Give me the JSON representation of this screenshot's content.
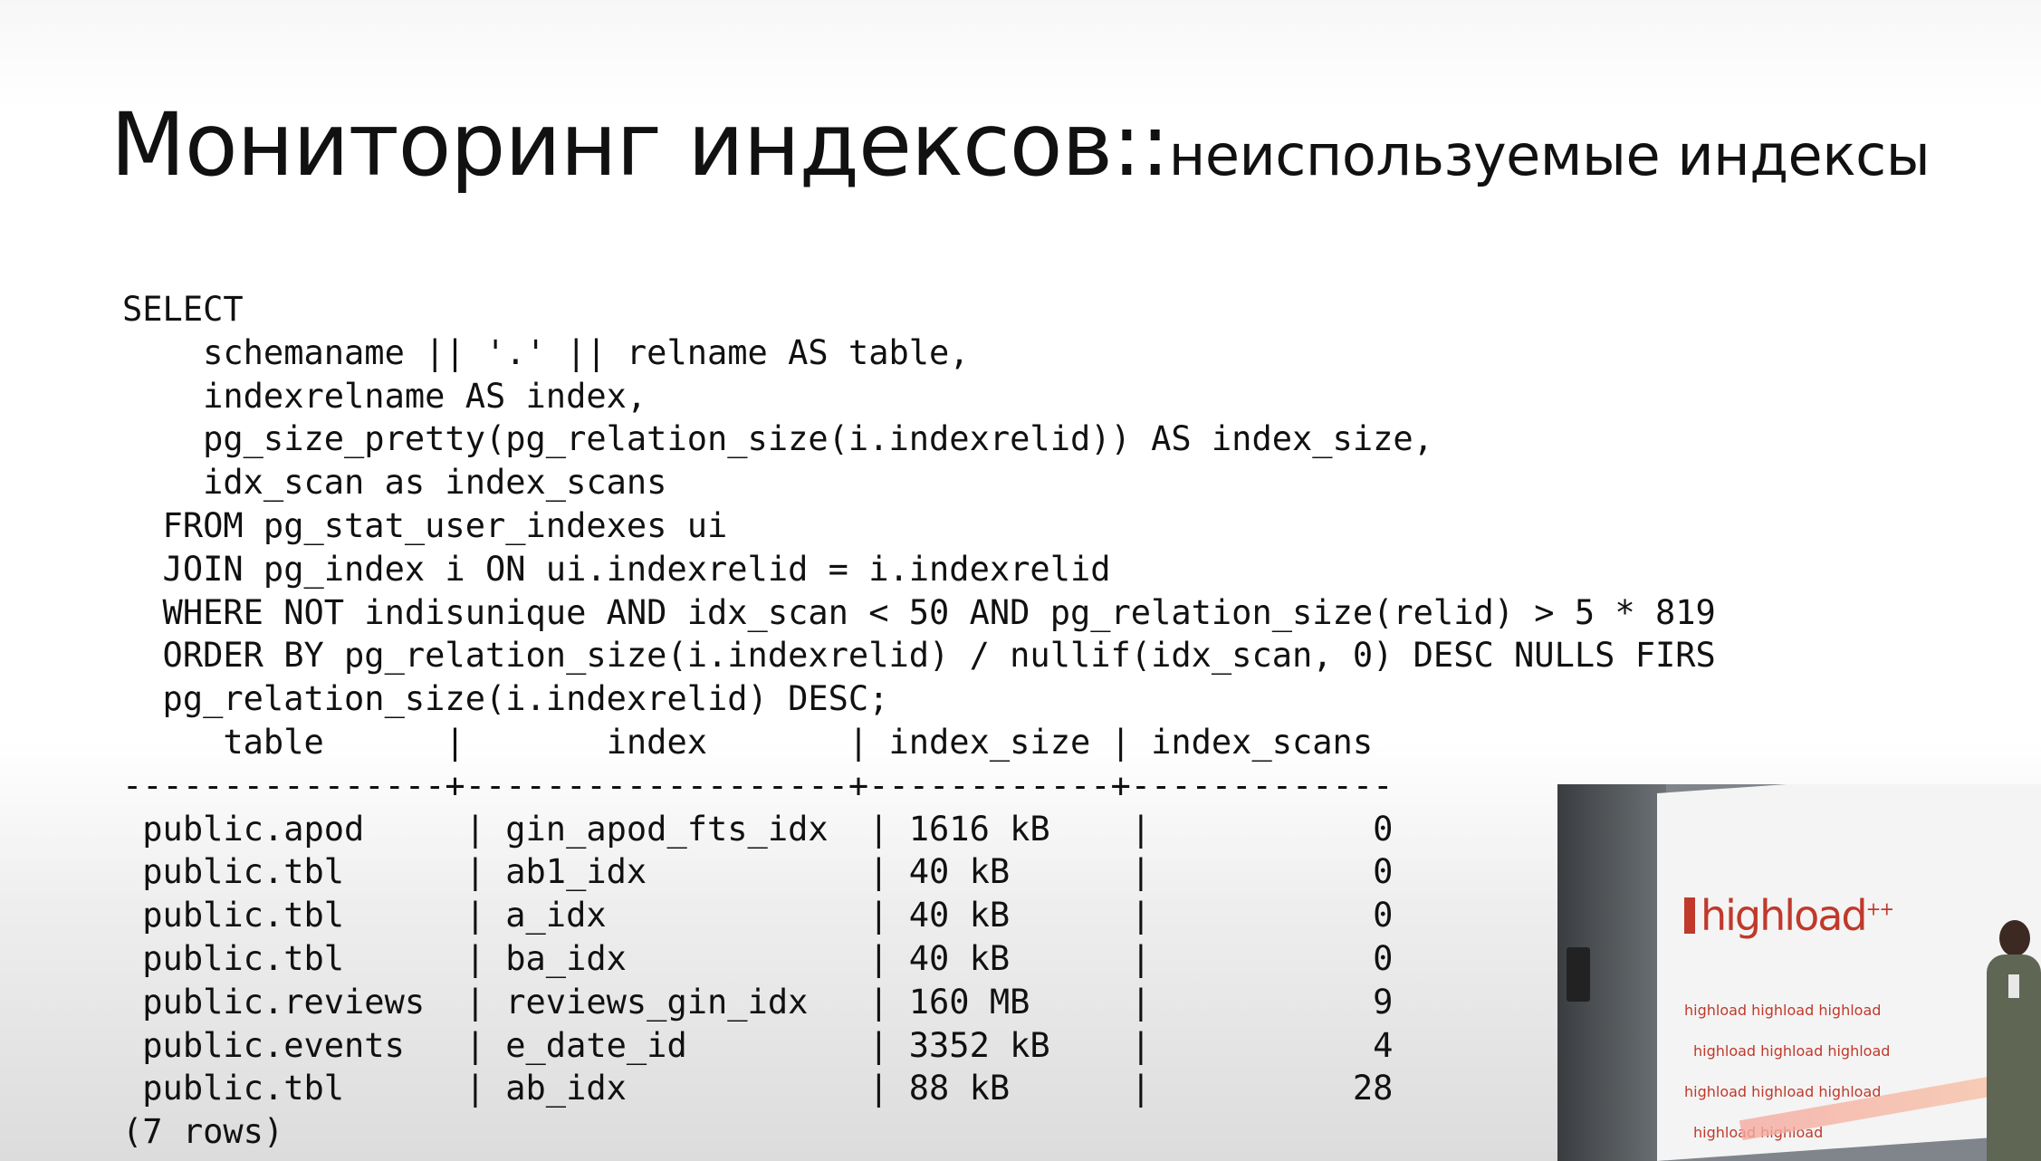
{
  "slide": {
    "title_main": "Мониторинг индексов::",
    "title_sub": "неиспользуемые индексы"
  },
  "query_lines": [
    "SELECT",
    "    schemaname || '.' || relname AS table,",
    "    indexrelname AS index,",
    "    pg_size_pretty(pg_relation_size(i.indexrelid)) AS index_size,",
    "    idx_scan as index_scans",
    "  FROM pg_stat_user_indexes ui",
    "  JOIN pg_index i ON ui.indexrelid = i.indexrelid",
    "  WHERE NOT indisunique AND idx_scan < 50 AND pg_relation_size(relid) > 5 * 819",
    "  ORDER BY pg_relation_size(i.indexrelid) / nullif(idx_scan, 0) DESC NULLS FIRS",
    "  pg_relation_size(i.indexrelid) DESC;"
  ],
  "result": {
    "header_line": "     table      |       index       | index_size | index_scans",
    "separator_line": "----------------+-------------------+------------+-------------",
    "rows": [
      " public.apod     | gin_apod_fts_idx  | 1616 kB    |           0",
      " public.tbl      | ab1_idx           | 40 kB      |           0",
      " public.tbl      | a_idx             | 40 kB      |           0",
      " public.tbl      | ba_idx            | 40 kB      |           0",
      " public.reviews  | reviews_gin_idx   | 160 MB     |           9",
      " public.events   | e_date_id         | 3352 kB    |           4",
      " public.tbl      | ab_idx            | 88 kB      |          28"
    ],
    "footer": "(7 rows)"
  },
  "video": {
    "logo_text": "highload",
    "logo_sup": "++",
    "banner_logo_rows": [
      "highload   highload   highload",
      "highload   highload   highload",
      "highload   highload   highload",
      "highload   highload"
    ]
  }
}
